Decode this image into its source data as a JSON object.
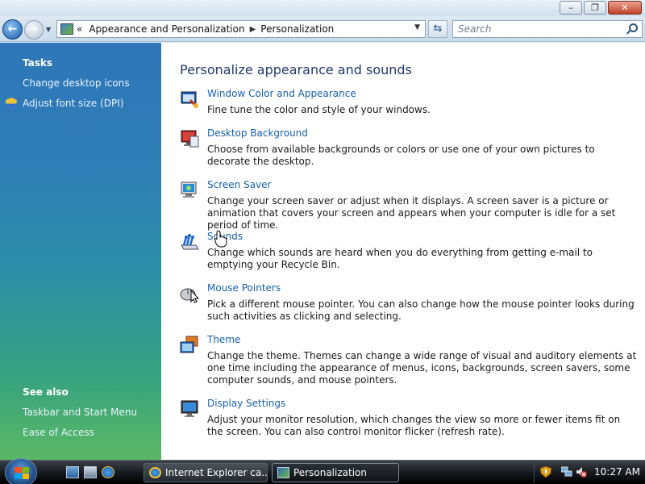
{
  "window": {
    "caption_buttons": [
      "minimize",
      "maximize",
      "close"
    ]
  },
  "navbar": {
    "breadcrumb_overflow": "«",
    "breadcrumbs": [
      "Appearance and Personalization",
      "Personalization"
    ],
    "search_placeholder": "Search"
  },
  "sidebar": {
    "tasks_title": "Tasks",
    "tasks": [
      {
        "label": "Change desktop icons"
      },
      {
        "label": "Adjust font size (DPI)",
        "icon": "shield-icon"
      }
    ],
    "see_also_title": "See also",
    "see_also": [
      {
        "label": "Taskbar and Start Menu"
      },
      {
        "label": "Ease of Access"
      }
    ]
  },
  "main": {
    "heading": "Personalize appearance and sounds",
    "items": [
      {
        "title": "Window Color and Appearance",
        "description": "Fine tune the color and style of your windows.",
        "icon": "window-color-icon"
      },
      {
        "title": "Desktop Background",
        "description": "Choose from available backgrounds or colors or use one of your own pictures to decorate the desktop.",
        "icon": "desktop-background-icon"
      },
      {
        "title": "Screen Saver",
        "description": "Change your screen saver or adjust when it displays. A screen saver is a picture or animation that covers your screen and appears when your computer is idle for a set period of time.",
        "icon": "screen-saver-icon"
      },
      {
        "title": "Sounds",
        "description": "Change which sounds are heard when you do everything from getting e-mail to emptying your Recycle Bin.",
        "icon": "sounds-icon"
      },
      {
        "title": "Mouse Pointers",
        "description": "Pick a different mouse pointer. You can also change how the mouse pointer looks during such activities as clicking and selecting.",
        "icon": "mouse-pointer-icon"
      },
      {
        "title": "Theme",
        "description": "Change the theme. Themes can change a wide range of visual and auditory elements at one time including the appearance of menus, icons, backgrounds, screen savers, some computer sounds, and mouse pointers.",
        "icon": "theme-icon"
      },
      {
        "title": "Display Settings",
        "description": "Adjust your monitor resolution, which changes the view so more or fewer items fit on the screen. You can also control monitor flicker (refresh rate).",
        "icon": "display-settings-icon"
      }
    ]
  },
  "taskbar": {
    "buttons": [
      {
        "label": "Internet Explorer ca...",
        "icon": "internet-explorer-icon"
      },
      {
        "label": "Personalization",
        "icon": "personalization-icon"
      }
    ],
    "clock": "10:27 AM"
  },
  "colors": {
    "link": "#1660b0",
    "heading": "#1e3a6e",
    "sidebar_top": "#2e76b8",
    "sidebar_bottom": "#5ab864"
  }
}
